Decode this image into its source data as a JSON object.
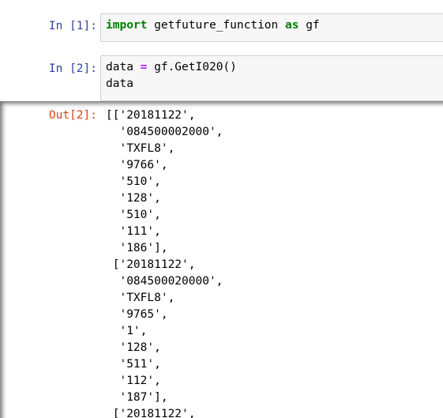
{
  "cells": [
    {
      "prompt": "In [1]:",
      "code_parts": [
        {
          "text": "import",
          "type": "keyword"
        },
        {
          "text": " getfuture_function ",
          "type": "plain"
        },
        {
          "text": "as",
          "type": "keyword"
        },
        {
          "text": " gf",
          "type": "plain"
        }
      ]
    },
    {
      "prompt": "In [2]:",
      "line1_parts": [
        {
          "text": "data ",
          "type": "plain"
        },
        {
          "text": "=",
          "type": "operator"
        },
        {
          "text": " gf.GetI020()",
          "type": "plain"
        }
      ],
      "line2": "data"
    }
  ],
  "output": {
    "prompt": "Out[2]:",
    "lines": [
      "[['20181122',",
      "  '084500002000',",
      "  'TXFL8',",
      "  '9766',",
      "  '510',",
      "  '128',",
      "  '510',",
      "  '111',",
      "  '186'],",
      " ['20181122',",
      "  '084500020000',",
      "  'TXFL8',",
      "  '9765',",
      "  '1',",
      "  '128',",
      "  '511',",
      "  '112',",
      "  '187'],",
      " ['20181122',"
    ]
  }
}
